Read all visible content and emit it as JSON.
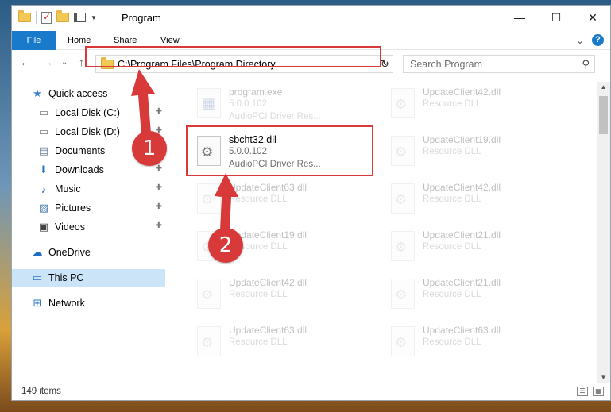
{
  "window": {
    "title": "Program",
    "controls": {
      "minimize": "—",
      "maximize": "☐",
      "close": "✕"
    }
  },
  "ribbon": {
    "tabs": [
      "File",
      "Home",
      "Share",
      "View"
    ],
    "expand_glyph": "⌄",
    "help_glyph": "?"
  },
  "navigation": {
    "back": "←",
    "forward": "→",
    "recent": "⌄",
    "up": "↑",
    "address": "C:\\Program Files\\Program Directory",
    "address_dropdown": "⌄",
    "refresh": "↻",
    "search_placeholder": "Search Program",
    "search_icon": "🔍"
  },
  "sidebar": {
    "items": [
      {
        "label": "Quick access",
        "icon": "star-icon",
        "glyph": "★",
        "pinned": false
      },
      {
        "label": "Local Disk (C:)",
        "icon": "drive-icon",
        "glyph": "▭",
        "pinned": true
      },
      {
        "label": "Local Disk (D:)",
        "icon": "drive-icon",
        "glyph": "▭",
        "pinned": true
      },
      {
        "label": "Documents",
        "icon": "documents-icon",
        "glyph": "▤",
        "pinned": true
      },
      {
        "label": "Downloads",
        "icon": "download-icon",
        "glyph": "⬇",
        "pinned": true
      },
      {
        "label": "Music",
        "icon": "music-icon",
        "glyph": "♪",
        "pinned": true
      },
      {
        "label": "Pictures",
        "icon": "pictures-icon",
        "glyph": "▨",
        "pinned": true
      },
      {
        "label": "Videos",
        "icon": "videos-icon",
        "glyph": "▣",
        "pinned": true
      },
      {
        "label": "OneDrive",
        "icon": "cloud-icon",
        "glyph": "☁",
        "pinned": false
      },
      {
        "label": "This PC",
        "icon": "computer-icon",
        "glyph": "▭",
        "pinned": false,
        "selected": true
      },
      {
        "label": "Network",
        "icon": "network-icon",
        "glyph": "⊞",
        "pinned": false
      }
    ],
    "pin_glyph": "📌"
  },
  "files": [
    {
      "name": "program.exe",
      "line2": "5.0.0.102",
      "line3": "AudioPCI Driver Res...",
      "type": "exe",
      "faded": true
    },
    {
      "name": "UpdateClient42.dll",
      "line2": "Resource DLL",
      "line3": "",
      "type": "dll",
      "faded": true
    },
    {
      "name": "sbcht32.dll",
      "line2": "5.0.0.102",
      "line3": "AudioPCI Driver Res...",
      "type": "dll",
      "faded": false
    },
    {
      "name": "UpdateClient19.dll",
      "line2": "Resource DLL",
      "line3": "",
      "type": "dll",
      "faded": true
    },
    {
      "name": "UpdateClient63.dll",
      "line2": "Resource DLL",
      "line3": "",
      "type": "dll",
      "faded": true
    },
    {
      "name": "UpdateClient42.dll",
      "line2": "Resource DLL",
      "line3": "",
      "type": "dll",
      "faded": true
    },
    {
      "name": "UpdateClient19.dll",
      "line2": "Resource DLL",
      "line3": "",
      "type": "dll",
      "faded": true
    },
    {
      "name": "UpdateClient21.dll",
      "line2": "Resource DLL",
      "line3": "",
      "type": "dll",
      "faded": true
    },
    {
      "name": "UpdateClient42.dll",
      "line2": "Resource DLL",
      "line3": "",
      "type": "dll",
      "faded": true
    },
    {
      "name": "UpdateClient21.dll",
      "line2": "Resource DLL",
      "line3": "",
      "type": "dll",
      "faded": true
    },
    {
      "name": "UpdateClient63.dll",
      "line2": "Resource DLL",
      "line3": "",
      "type": "dll",
      "faded": true
    },
    {
      "name": "UpdateClient63.dll",
      "line2": "Resource DLL",
      "line3": "",
      "type": "dll",
      "faded": true
    }
  ],
  "status": {
    "item_count": "149 items",
    "details_view_glyph": "☰",
    "icons_view_glyph": "▦"
  },
  "annotations": {
    "step1": "1",
    "step2": "2",
    "accent_color": "#d83a3a"
  },
  "colors": {
    "file_tab": "#1979ca",
    "selection": "#cce4f7"
  }
}
